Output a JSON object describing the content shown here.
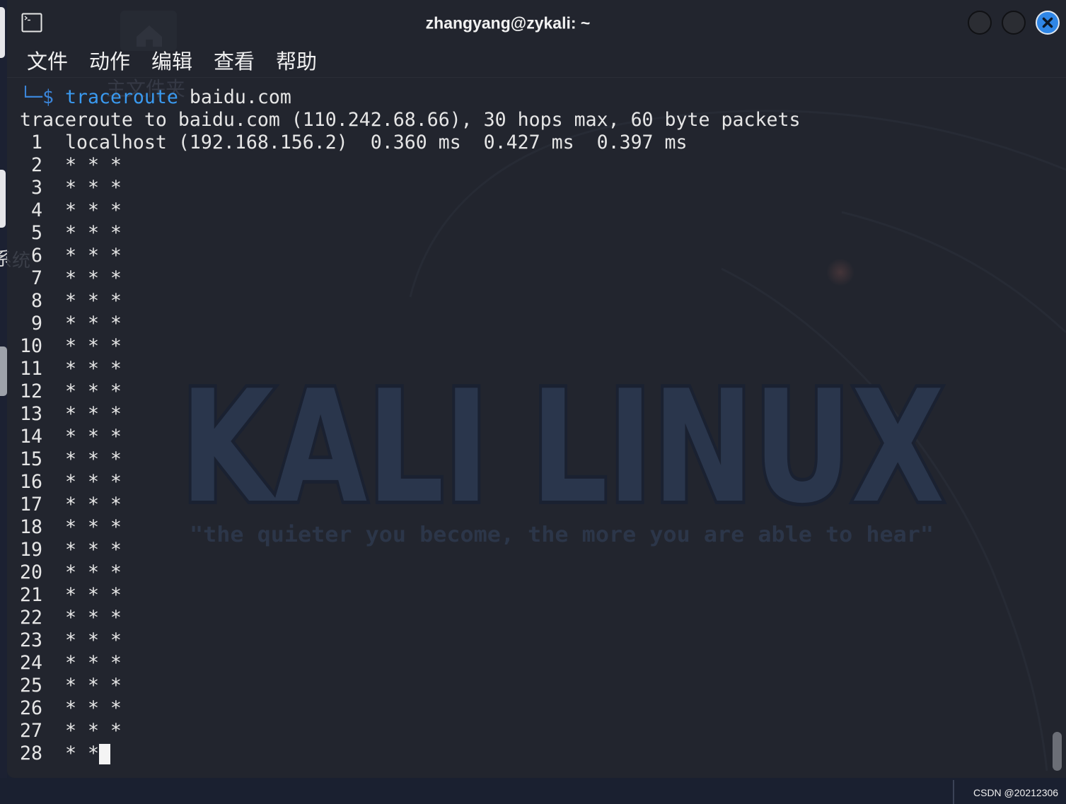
{
  "window": {
    "title": "zhangyang@zykali: ~",
    "app_icon": "terminal-icon",
    "controls": {
      "minimize_icon": "circle-icon",
      "maximize_icon": "circle-icon",
      "close_icon": "close-icon"
    }
  },
  "menu": {
    "items": [
      "文件",
      "动作",
      "编辑",
      "查看",
      "帮助"
    ]
  },
  "terminal": {
    "prompt": "└─$",
    "command": "traceroute",
    "argument": "baidu.com",
    "output": [
      "traceroute to baidu.com (110.242.68.66), 30 hops max, 60 byte packets",
      " 1  localhost (192.168.156.2)  0.360 ms  0.427 ms  0.397 ms",
      " 2  * * *",
      " 3  * * *",
      " 4  * * *",
      " 5  * * *",
      " 6  * * *",
      " 7  * * *",
      " 8  * * *",
      " 9  * * *",
      "10  * * *",
      "11  * * *",
      "12  * * *",
      "13  * * *",
      "14  * * *",
      "15  * * *",
      "16  * * *",
      "17  * * *",
      "18  * * *",
      "19  * * *",
      "20  * * *",
      "21  * * *",
      "22  * * *",
      "23  * * *",
      "24  * * *",
      "25  * * *",
      "26  * * *",
      "27  * * *"
    ],
    "current_line": "28  * *"
  },
  "scrollbar": {
    "scroll_fraction": 1
  },
  "wallpaper": {
    "logo_text": "KALI LINUX",
    "tagline": "\"the quieter you become, the more you are able to hear\""
  },
  "desktop": {
    "home_folder_label": "主文件夹",
    "file_system_label_fragment": "系统",
    "home_icon": "home-icon"
  },
  "watermark": "CSDN @20212306",
  "colors": {
    "terminal_background": "#22252e",
    "text": "#e6e6e6",
    "prompt": "#3b85d9",
    "command": "#3a9af0",
    "close_button": "#2f86e6",
    "desktop_background": "#1a2030"
  }
}
